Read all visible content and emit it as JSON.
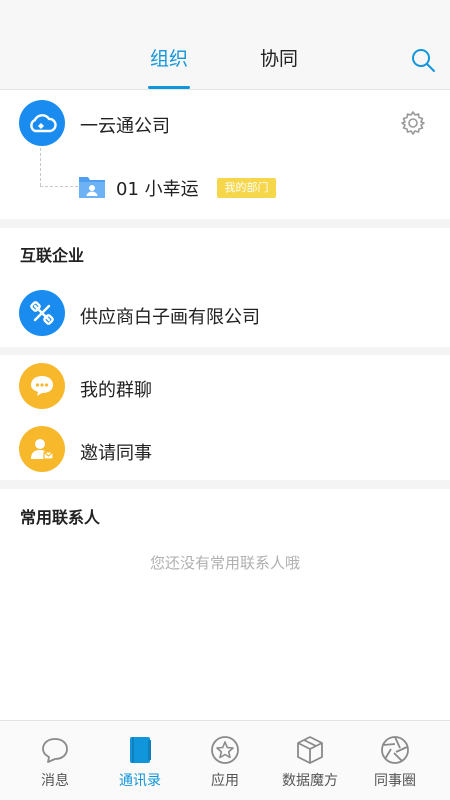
{
  "header": {
    "tabs": [
      {
        "label": "组织",
        "active": true
      },
      {
        "label": "协同",
        "active": false
      }
    ],
    "search_icon": "search-icon"
  },
  "org": {
    "company_name": "一云通公司",
    "department": {
      "name": "01 小幸运",
      "badge": "我的部门"
    }
  },
  "interconnect": {
    "title": "互联企业",
    "items": [
      {
        "name": "供应商白子画有限公司"
      }
    ]
  },
  "shortcuts": [
    {
      "label": "我的群聊",
      "icon": "chat-bubble-icon"
    },
    {
      "label": "邀请同事",
      "icon": "invite-user-icon"
    }
  ],
  "frequent": {
    "title": "常用联系人",
    "empty_text": "您还没有常用联系人哦"
  },
  "tabbar": [
    {
      "label": "消息",
      "icon": "message-icon",
      "active": false
    },
    {
      "label": "通讯录",
      "icon": "contacts-book-icon",
      "active": true
    },
    {
      "label": "应用",
      "icon": "star-icon",
      "active": false
    },
    {
      "label": "数据魔方",
      "icon": "cube-icon",
      "active": false
    },
    {
      "label": "同事圈",
      "icon": "aperture-icon",
      "active": false
    }
  ],
  "colors": {
    "accent": "#1296db",
    "company_avatar": "#1a8cf0",
    "shortcut_avatar": "#f7b82b",
    "badge": "#f6d64a"
  }
}
